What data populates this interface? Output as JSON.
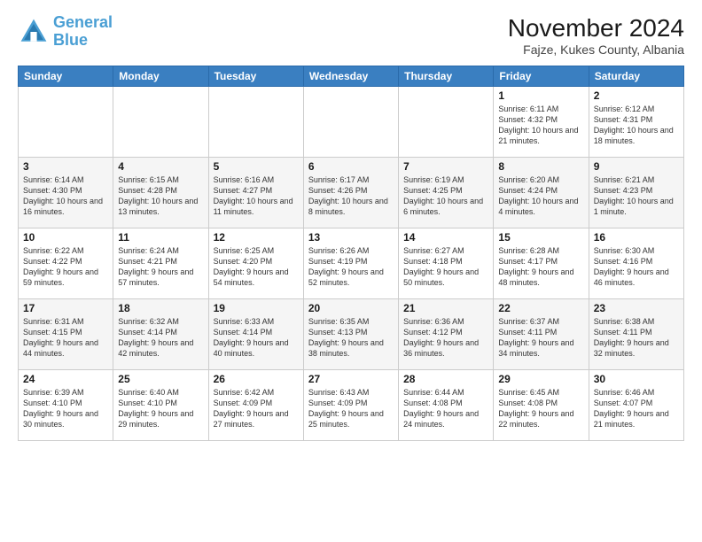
{
  "logo": {
    "line1": "General",
    "line2": "Blue"
  },
  "header": {
    "month": "November 2024",
    "location": "Fajze, Kukes County, Albania"
  },
  "days_of_week": [
    "Sunday",
    "Monday",
    "Tuesday",
    "Wednesday",
    "Thursday",
    "Friday",
    "Saturday"
  ],
  "weeks": [
    [
      {
        "day": "",
        "info": ""
      },
      {
        "day": "",
        "info": ""
      },
      {
        "day": "",
        "info": ""
      },
      {
        "day": "",
        "info": ""
      },
      {
        "day": "",
        "info": ""
      },
      {
        "day": "1",
        "info": "Sunrise: 6:11 AM\nSunset: 4:32 PM\nDaylight: 10 hours and 21 minutes."
      },
      {
        "day": "2",
        "info": "Sunrise: 6:12 AM\nSunset: 4:31 PM\nDaylight: 10 hours and 18 minutes."
      }
    ],
    [
      {
        "day": "3",
        "info": "Sunrise: 6:14 AM\nSunset: 4:30 PM\nDaylight: 10 hours and 16 minutes."
      },
      {
        "day": "4",
        "info": "Sunrise: 6:15 AM\nSunset: 4:28 PM\nDaylight: 10 hours and 13 minutes."
      },
      {
        "day": "5",
        "info": "Sunrise: 6:16 AM\nSunset: 4:27 PM\nDaylight: 10 hours and 11 minutes."
      },
      {
        "day": "6",
        "info": "Sunrise: 6:17 AM\nSunset: 4:26 PM\nDaylight: 10 hours and 8 minutes."
      },
      {
        "day": "7",
        "info": "Sunrise: 6:19 AM\nSunset: 4:25 PM\nDaylight: 10 hours and 6 minutes."
      },
      {
        "day": "8",
        "info": "Sunrise: 6:20 AM\nSunset: 4:24 PM\nDaylight: 10 hours and 4 minutes."
      },
      {
        "day": "9",
        "info": "Sunrise: 6:21 AM\nSunset: 4:23 PM\nDaylight: 10 hours and 1 minute."
      }
    ],
    [
      {
        "day": "10",
        "info": "Sunrise: 6:22 AM\nSunset: 4:22 PM\nDaylight: 9 hours and 59 minutes."
      },
      {
        "day": "11",
        "info": "Sunrise: 6:24 AM\nSunset: 4:21 PM\nDaylight: 9 hours and 57 minutes."
      },
      {
        "day": "12",
        "info": "Sunrise: 6:25 AM\nSunset: 4:20 PM\nDaylight: 9 hours and 54 minutes."
      },
      {
        "day": "13",
        "info": "Sunrise: 6:26 AM\nSunset: 4:19 PM\nDaylight: 9 hours and 52 minutes."
      },
      {
        "day": "14",
        "info": "Sunrise: 6:27 AM\nSunset: 4:18 PM\nDaylight: 9 hours and 50 minutes."
      },
      {
        "day": "15",
        "info": "Sunrise: 6:28 AM\nSunset: 4:17 PM\nDaylight: 9 hours and 48 minutes."
      },
      {
        "day": "16",
        "info": "Sunrise: 6:30 AM\nSunset: 4:16 PM\nDaylight: 9 hours and 46 minutes."
      }
    ],
    [
      {
        "day": "17",
        "info": "Sunrise: 6:31 AM\nSunset: 4:15 PM\nDaylight: 9 hours and 44 minutes."
      },
      {
        "day": "18",
        "info": "Sunrise: 6:32 AM\nSunset: 4:14 PM\nDaylight: 9 hours and 42 minutes."
      },
      {
        "day": "19",
        "info": "Sunrise: 6:33 AM\nSunset: 4:14 PM\nDaylight: 9 hours and 40 minutes."
      },
      {
        "day": "20",
        "info": "Sunrise: 6:35 AM\nSunset: 4:13 PM\nDaylight: 9 hours and 38 minutes."
      },
      {
        "day": "21",
        "info": "Sunrise: 6:36 AM\nSunset: 4:12 PM\nDaylight: 9 hours and 36 minutes."
      },
      {
        "day": "22",
        "info": "Sunrise: 6:37 AM\nSunset: 4:11 PM\nDaylight: 9 hours and 34 minutes."
      },
      {
        "day": "23",
        "info": "Sunrise: 6:38 AM\nSunset: 4:11 PM\nDaylight: 9 hours and 32 minutes."
      }
    ],
    [
      {
        "day": "24",
        "info": "Sunrise: 6:39 AM\nSunset: 4:10 PM\nDaylight: 9 hours and 30 minutes."
      },
      {
        "day": "25",
        "info": "Sunrise: 6:40 AM\nSunset: 4:10 PM\nDaylight: 9 hours and 29 minutes."
      },
      {
        "day": "26",
        "info": "Sunrise: 6:42 AM\nSunset: 4:09 PM\nDaylight: 9 hours and 27 minutes."
      },
      {
        "day": "27",
        "info": "Sunrise: 6:43 AM\nSunset: 4:09 PM\nDaylight: 9 hours and 25 minutes."
      },
      {
        "day": "28",
        "info": "Sunrise: 6:44 AM\nSunset: 4:08 PM\nDaylight: 9 hours and 24 minutes."
      },
      {
        "day": "29",
        "info": "Sunrise: 6:45 AM\nSunset: 4:08 PM\nDaylight: 9 hours and 22 minutes."
      },
      {
        "day": "30",
        "info": "Sunrise: 6:46 AM\nSunset: 4:07 PM\nDaylight: 9 hours and 21 minutes."
      }
    ]
  ]
}
